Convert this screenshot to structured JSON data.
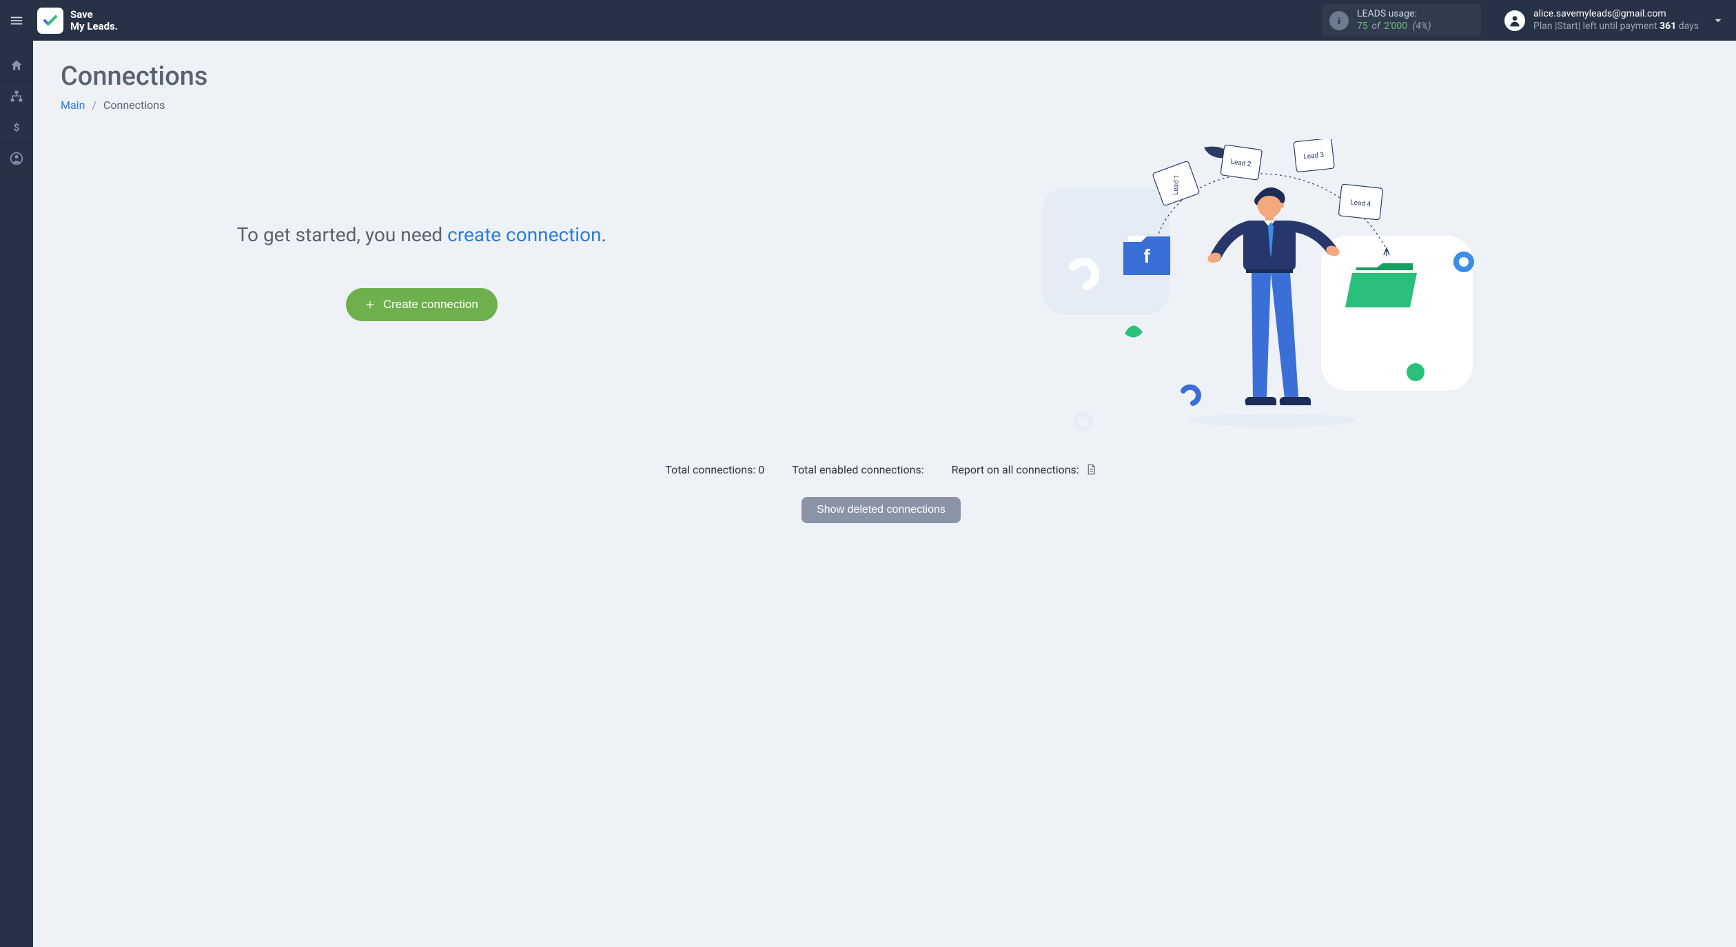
{
  "brand": {
    "line1": "Save",
    "line2": "My Leads."
  },
  "usage": {
    "label": "LEADS usage:",
    "used": "75",
    "of_word": "of",
    "limit": "2'000",
    "percent": "(4%)"
  },
  "account": {
    "email": "alice.savemyleads@gmail.com",
    "plan_prefix": "Plan |",
    "plan_name": "Start",
    "plan_mid": "| left until payment",
    "days_num": "361",
    "days_word": "days"
  },
  "page": {
    "title": "Connections",
    "breadcrumb_main": "Main",
    "breadcrumb_current": "Connections"
  },
  "hero": {
    "msg_prefix": "To get started, you need ",
    "msg_highlight": "create connection",
    "msg_suffix": ".",
    "create_btn": "Create connection"
  },
  "illus": {
    "lead1": "Lead 1",
    "lead2": "Lead 2",
    "lead3": "Lead 3",
    "lead4": "Lead 4"
  },
  "stats": {
    "total_label": "Total connections:",
    "total_value": "0",
    "enabled_label": "Total enabled connections:",
    "report_label": "Report on all connections:"
  },
  "buttons": {
    "show_deleted": "Show deleted connections"
  }
}
